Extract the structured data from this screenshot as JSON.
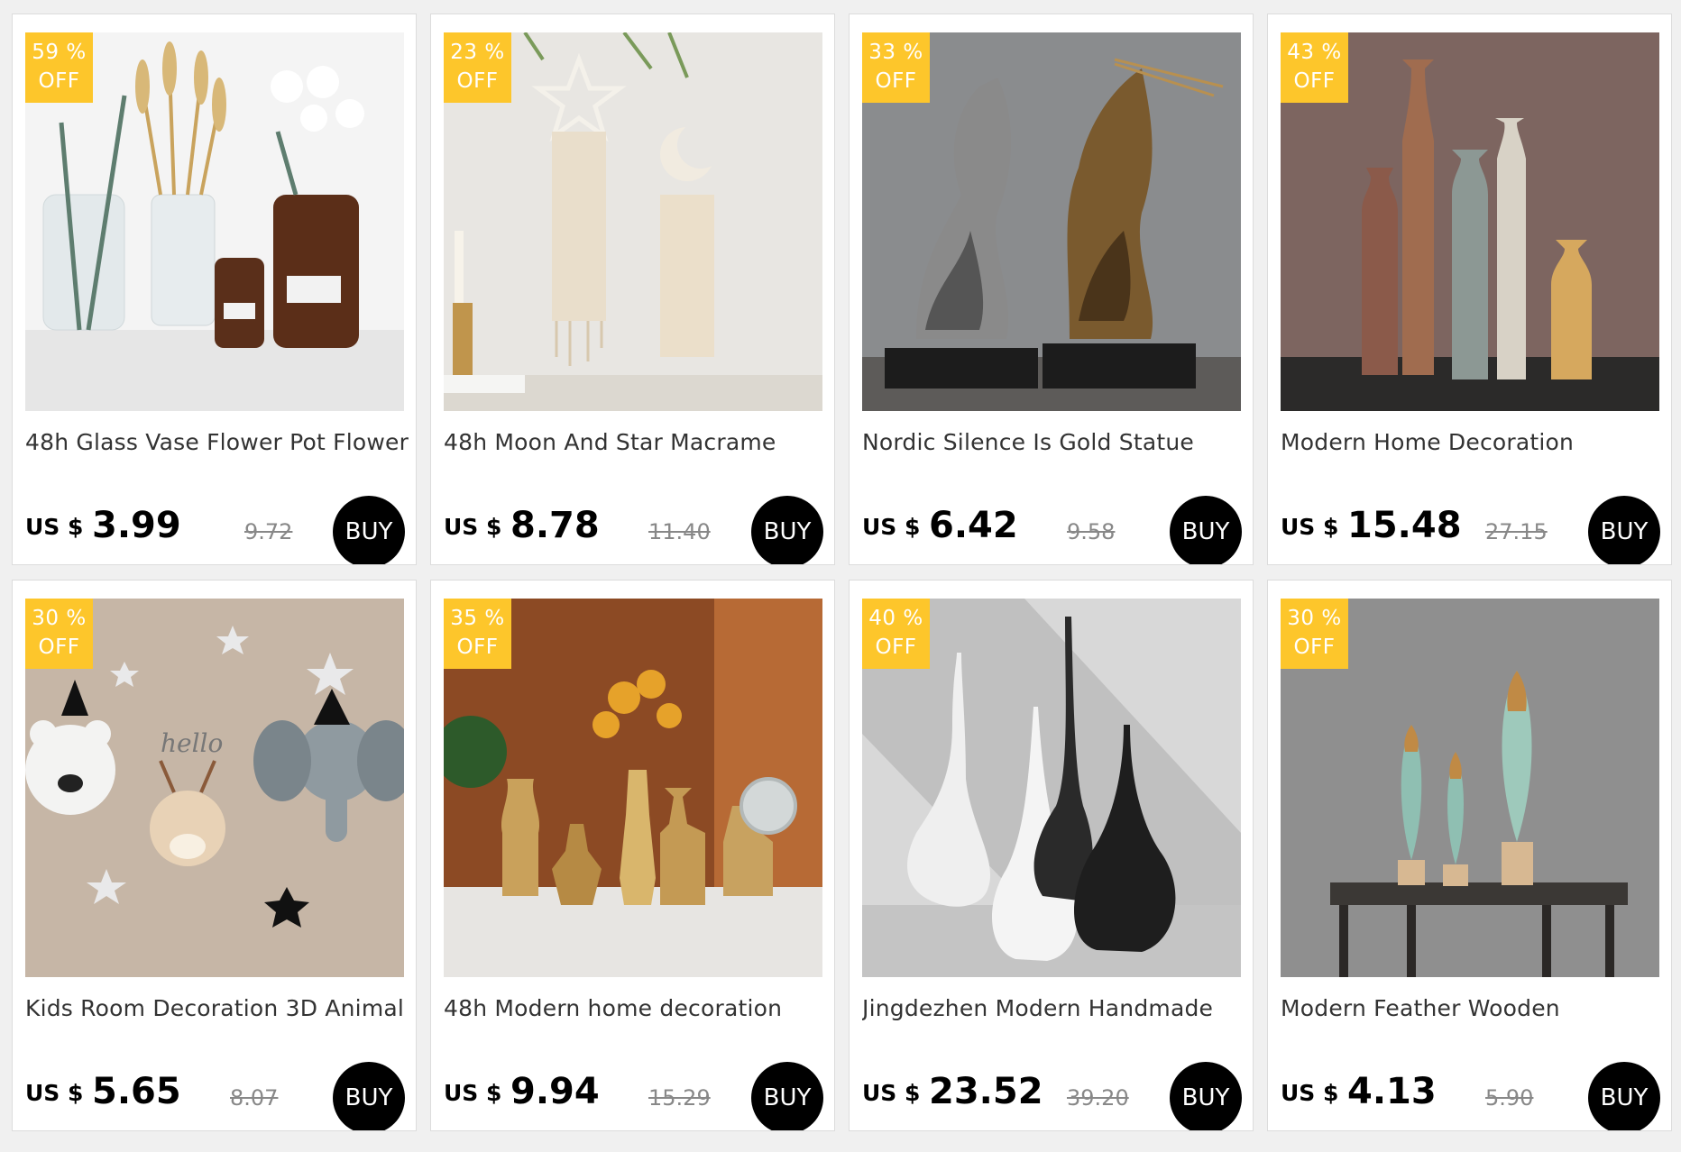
{
  "products": [
    {
      "discount_pct": "59 %",
      "discount_off": "OFF",
      "title": "48h Glass Vase Flower Pot Flower",
      "currency": "US $",
      "price": "3.99",
      "old_price": "9.72",
      "buy_label": "BUY"
    },
    {
      "discount_pct": "23 %",
      "discount_off": "OFF",
      "title": "48h Moon And Star Macrame",
      "currency": "US $",
      "price": "8.78",
      "old_price": "11.40",
      "buy_label": "BUY"
    },
    {
      "discount_pct": "33 %",
      "discount_off": "OFF",
      "title": "Nordic Silence Is Gold Statue",
      "currency": "US $",
      "price": "6.42",
      "old_price": "9.58",
      "buy_label": "BUY"
    },
    {
      "discount_pct": "43 %",
      "discount_off": "OFF",
      "title": "Modern Home Decoration",
      "currency": "US $",
      "price": "15.48",
      "old_price": "27.15",
      "buy_label": "BUY"
    },
    {
      "discount_pct": "30 %",
      "discount_off": "OFF",
      "title": "Kids Room Decoration 3D Animal",
      "currency": "US $",
      "price": "5.65",
      "old_price": "8.07",
      "buy_label": "BUY"
    },
    {
      "discount_pct": "35 %",
      "discount_off": "OFF",
      "title": "48h Modern home decoration",
      "currency": "US $",
      "price": "9.94",
      "old_price": "15.29",
      "buy_label": "BUY"
    },
    {
      "discount_pct": "40 %",
      "discount_off": "OFF",
      "title": "Jingdezhen Modern Handmade",
      "currency": "US $",
      "price": "23.52",
      "old_price": "39.20",
      "buy_label": "BUY"
    },
    {
      "discount_pct": "30 %",
      "discount_off": "OFF",
      "title": "Modern Feather Wooden",
      "currency": "US $",
      "price": "4.13",
      "old_price": "5.90",
      "buy_label": "BUY"
    }
  ],
  "colors": {
    "badge": "#fdc62b",
    "buy_button": "#000000",
    "old_price": "#888888"
  }
}
